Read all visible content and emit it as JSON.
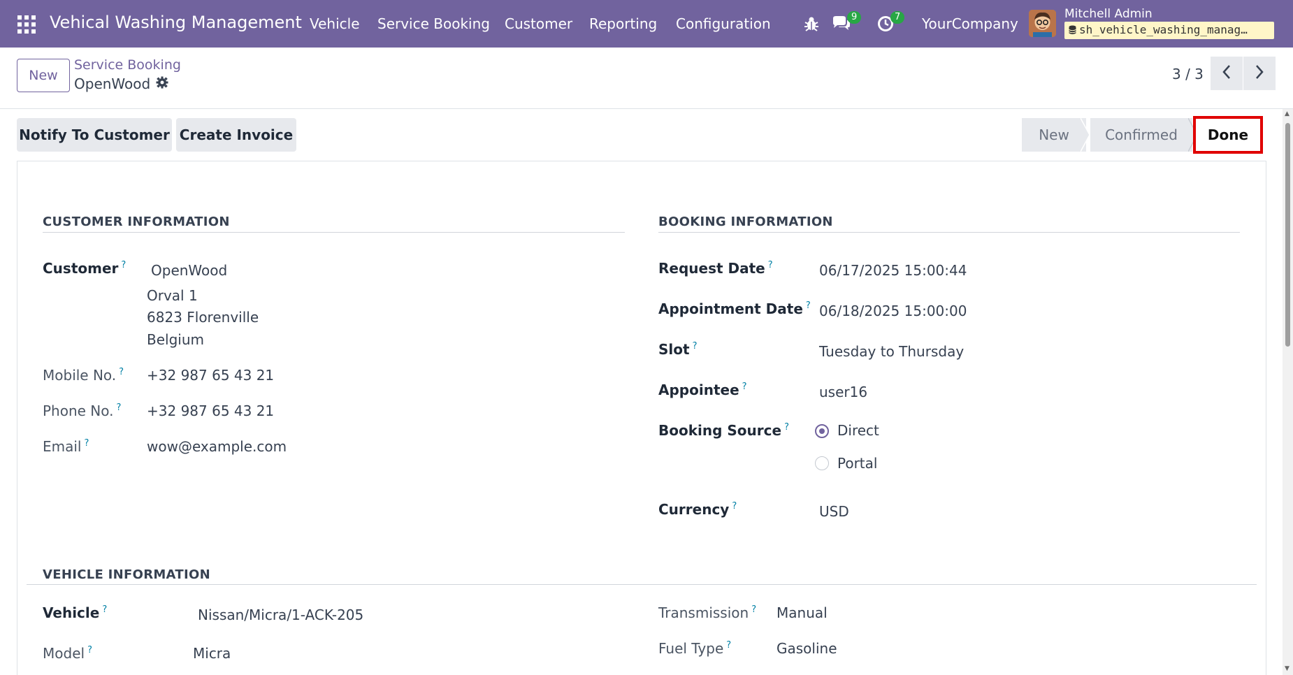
{
  "navbar": {
    "app_title": "Vehical Washing Management",
    "menu": [
      "Vehicle",
      "Service Booking",
      "Customer",
      "Reporting",
      "Configuration"
    ],
    "messages_count": "9",
    "activities_count": "7",
    "company": "YourCompany",
    "user_name": "Mitchell Admin",
    "database": "sh_vehicle_washing_manag…",
    "icons": [
      "apps-icon",
      "bug-icon",
      "chat-icon",
      "clock-icon",
      "database-icon"
    ],
    "color": "#71639e"
  },
  "control": {
    "new_label": "New",
    "breadcrumb": "Service Booking",
    "record_name": "OpenWood",
    "pager": "3 / 3"
  },
  "actions": {
    "notify": "Notify To Customer",
    "invoice": "Create Invoice"
  },
  "statusbar": {
    "stages": [
      "New",
      "Confirmed",
      "Done"
    ],
    "current": "Done"
  },
  "customer_section": {
    "title": "CUSTOMER INFORMATION",
    "customer_label": "Customer",
    "customer_name": "OpenWood",
    "address_line1": "Orval 1",
    "address_line2": "6823 Florenville",
    "address_line3": "Belgium",
    "mobile_label": "Mobile No.",
    "mobile": "+32 987 65 43 21",
    "phone_label": "Phone No.",
    "phone": "+32 987 65 43 21",
    "email_label": "Email",
    "email": "wow@example.com"
  },
  "booking_section": {
    "title": "BOOKING INFORMATION",
    "request_date_label": "Request Date",
    "request_date": "06/17/2025 15:00:44",
    "appointment_date_label": "Appointment Date",
    "appointment_date": "06/18/2025 15:00:00",
    "slot_label": "Slot",
    "slot": "Tuesday to Thursday",
    "appointee_label": "Appointee",
    "appointee": "user16",
    "source_label": "Booking Source",
    "source_options": [
      "Direct",
      "Portal"
    ],
    "source_selected": "Direct",
    "currency_label": "Currency",
    "currency": "USD"
  },
  "vehicle_section": {
    "title": "VEHICLE INFORMATION",
    "vehicle_label": "Vehicle",
    "vehicle": "Nissan/Micra/1-ACK-205",
    "model_label": "Model",
    "model": "Micra",
    "transmission_label": "Transmission",
    "transmission": "Manual",
    "fuel_label": "Fuel Type",
    "fuel": "Gasoline"
  },
  "help_marker": "?"
}
